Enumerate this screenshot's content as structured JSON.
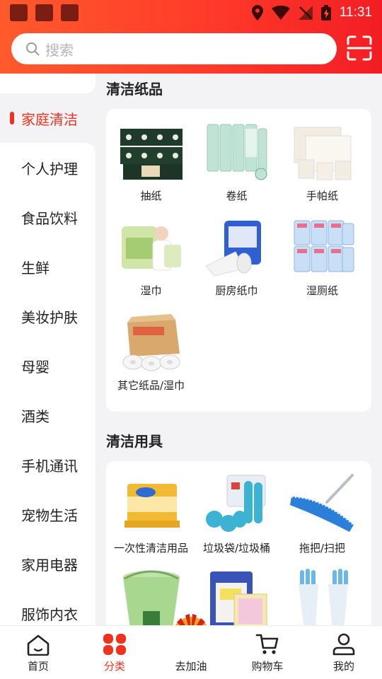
{
  "status": {
    "time": "11:31"
  },
  "search": {
    "placeholder": "搜索"
  },
  "sidebar": {
    "active": "家庭清洁",
    "items": [
      "个人护理",
      "食品饮料",
      "生鲜",
      "美妆护肤",
      "母婴",
      "酒类",
      "手机通讯",
      "宠物生活",
      "家用电器",
      "服饰内衣"
    ]
  },
  "sections": [
    {
      "title": "清洁纸品",
      "items": [
        "抽纸",
        "卷纸",
        "手帕纸",
        "湿巾",
        "厨房纸巾",
        "湿厕纸",
        "其它纸品/湿巾"
      ]
    },
    {
      "title": "清洁用具",
      "items": [
        "一次性清洁用品",
        "垃圾袋/垃圾桶",
        "拖把/扫把"
      ]
    }
  ],
  "bottom_nav": {
    "home": "首页",
    "category": "分类",
    "fuel": "去加油",
    "cart": "购物车",
    "mine": "我的"
  },
  "colors": {
    "accent": "#f0311e",
    "header_start": "#ff5a2c",
    "header_end": "#f21d24"
  }
}
